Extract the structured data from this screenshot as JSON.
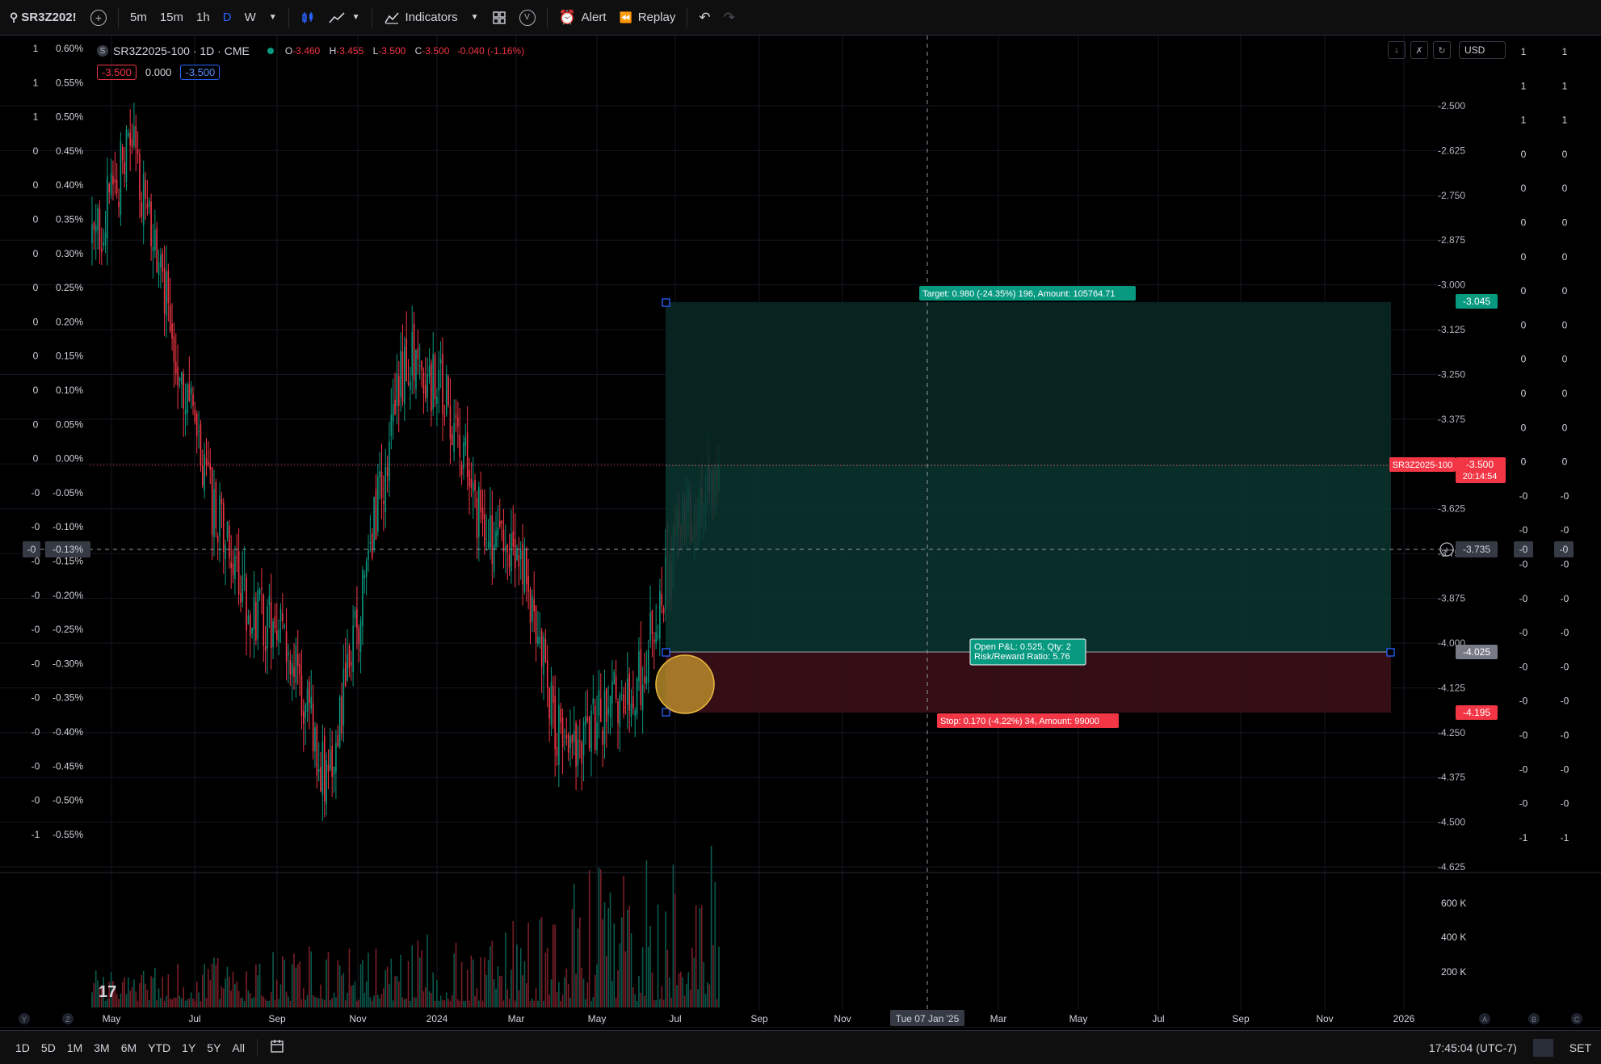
{
  "toolbar": {
    "symbol": "SR3Z202!",
    "intervals": [
      "5m",
      "15m",
      "1h",
      "D",
      "W"
    ],
    "active_interval": "D",
    "indicators_label": "Indicators",
    "alert_label": "Alert",
    "replay_label": "Replay",
    "v_label": "V"
  },
  "legend": {
    "symbol_badge": "S",
    "title": "SR3Z2025-100 · 1D · CME",
    "ohlc": [
      {
        "k": "O",
        "v": "-3.460"
      },
      {
        "k": "H",
        "v": "-3.455"
      },
      {
        "k": "L",
        "v": "-3.500"
      },
      {
        "k": "C",
        "v": "-3.500"
      }
    ],
    "change": "-0.040 (-1.16%)",
    "sell_price": "-3.500",
    "spread": "0.000",
    "buy_price": "-3.500"
  },
  "top_right": {
    "currency": "USD"
  },
  "left_axis": {
    "rows": [
      {
        "a": "1",
        "b": "0.60%"
      },
      {
        "a": "1",
        "b": "0.55%"
      },
      {
        "a": "1",
        "b": "0.50%"
      },
      {
        "a": "0",
        "b": "0.45%"
      },
      {
        "a": "0",
        "b": "0.40%"
      },
      {
        "a": "0",
        "b": "0.35%"
      },
      {
        "a": "0",
        "b": "0.30%"
      },
      {
        "a": "0",
        "b": "0.25%"
      },
      {
        "a": "0",
        "b": "0.20%"
      },
      {
        "a": "0",
        "b": "0.15%"
      },
      {
        "a": "0",
        "b": "0.10%"
      },
      {
        "a": "0",
        "b": "0.05%"
      },
      {
        "a": "0",
        "b": "0.00%"
      },
      {
        "a": "-0",
        "b": "-0.05%"
      },
      {
        "a": "-0",
        "b": "-0.10%"
      },
      {
        "a": "-0",
        "b": "-0.15%"
      },
      {
        "a": "-0",
        "b": "-0.20%"
      },
      {
        "a": "-0",
        "b": "-0.25%"
      },
      {
        "a": "-0",
        "b": "-0.30%"
      },
      {
        "a": "-0",
        "b": "-0.35%"
      },
      {
        "a": "-0",
        "b": "-0.40%"
      },
      {
        "a": "-0",
        "b": "-0.45%"
      },
      {
        "a": "-0",
        "b": "-0.50%"
      },
      {
        "a": "-1",
        "b": "-0.55%"
      }
    ],
    "crosshair_a": "-0",
    "crosshair_b": "-0.13%"
  },
  "right_axis": {
    "prices": [
      "-2.500",
      "-2.625",
      "-2.750",
      "-2.875",
      "-3.000",
      "-3.125",
      "-3.250",
      "-3.375",
      "-3.500",
      "-3.625",
      "-3.750",
      "-3.875",
      "-4.000",
      "-4.125",
      "-4.250",
      "-4.375",
      "-4.500",
      "-4.625"
    ],
    "col1": [
      "1",
      "1",
      "1",
      "0",
      "0",
      "0",
      "0",
      "0",
      "0",
      "0",
      "0",
      "0",
      "0",
      "-0",
      "-0",
      "-0",
      "-0",
      "-0",
      "-0",
      "-0",
      "-0",
      "-0",
      "-0",
      "-1"
    ],
    "col2": [
      "1",
      "1",
      "1",
      "0",
      "0",
      "0",
      "0",
      "0",
      "0",
      "0",
      "0",
      "0",
      "0",
      "-0",
      "-0",
      "-0",
      "-0",
      "-0",
      "-0",
      "-0",
      "-0",
      "-0",
      "-0",
      "-1"
    ],
    "crosshair_price": "-3.735",
    "crosshair_c1": "-0",
    "crosshair_c2": "-0",
    "target_price": "-3.045",
    "current_price": "-3.500",
    "countdown": "20:14:54",
    "symbol_tag": "SR3Z2025-100",
    "entry_price": "-4.025",
    "stop_price": "-4.195"
  },
  "volume_axis": [
    "600 K",
    "400 K",
    "200 K"
  ],
  "position_tool": {
    "target_label": "Target: 0.980 (-24.35%) 196, Amount: 105764.71",
    "pnl_line1": "Open P&L: 0.525, Qty: 2",
    "pnl_line2": "Risk/Reward Ratio: 5.76",
    "stop_label": "Stop: 0.170 (-4.22%) 34, Amount: 99000"
  },
  "time_axis": {
    "labels": [
      "May",
      "Jul",
      "Sep",
      "Nov",
      "2024",
      "Mar",
      "May",
      "Jul",
      "Sep",
      "Nov",
      "Mar",
      "May",
      "Jul",
      "Sep",
      "Nov",
      "2026"
    ],
    "crosshair_date": "Tue 07 Jan '25",
    "left_buttons": [
      "Y",
      "Z"
    ],
    "right_buttons": [
      "A",
      "B",
      "C"
    ]
  },
  "bottombar": {
    "ranges": [
      "1D",
      "5D",
      "1M",
      "3M",
      "6M",
      "YTD",
      "1Y",
      "5Y",
      "All"
    ],
    "clock": "17:45:04 (UTC-7)",
    "session": "SET"
  },
  "colors": {
    "up": "#089981",
    "down": "#f23645",
    "target_zone": "#0b3d36",
    "stop_zone": "#3b1117",
    "accent": "#2962ff"
  },
  "chart_data": {
    "type": "candlestick",
    "symbol": "SR3Z2025-100",
    "interval": "1D",
    "exchange": "CME",
    "y_range": [
      -4.625,
      -2.5
    ],
    "current": -3.5,
    "close_path": [
      {
        "t": "2023-04",
        "v": -2.9
      },
      {
        "t": "2023-05",
        "v": -2.6
      },
      {
        "t": "2023-06",
        "v": -3.1
      },
      {
        "t": "2023-07",
        "v": -3.6
      },
      {
        "t": "2023-08",
        "v": -3.9
      },
      {
        "t": "2023-09",
        "v": -4.0
      },
      {
        "t": "2023-10",
        "v": -4.4
      },
      {
        "t": "2023-11",
        "v": -3.8
      },
      {
        "t": "2023-12",
        "v": -3.2
      },
      {
        "t": "2024-01",
        "v": -3.3
      },
      {
        "t": "2024-02",
        "v": -3.7
      },
      {
        "t": "2024-03",
        "v": -3.8
      },
      {
        "t": "2024-04",
        "v": -4.3
      },
      {
        "t": "2024-05",
        "v": -4.2
      },
      {
        "t": "2024-06",
        "v": -4.1
      },
      {
        "t": "2024-07",
        "v": -3.7
      },
      {
        "t": "2024-08",
        "v": -3.5
      }
    ]
  }
}
